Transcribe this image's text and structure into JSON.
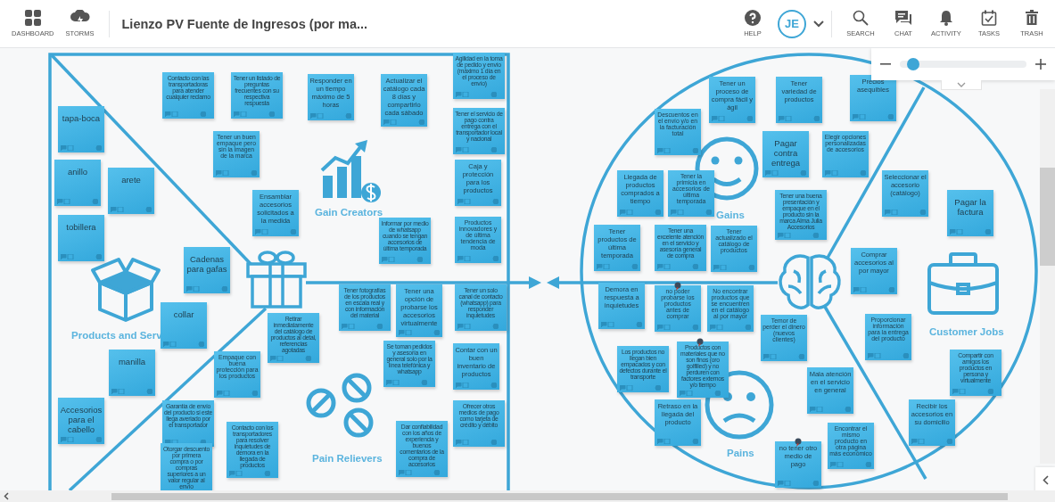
{
  "toolbar": {
    "left_buttons": [
      {
        "label": "DASHBOARD"
      },
      {
        "label": "STORMS"
      }
    ],
    "title": "Lienzo PV Fuente de Ingresos (por ma...",
    "avatar": "JE",
    "right_buttons": [
      {
        "label": "HELP"
      },
      {
        "label": "SEARCH"
      },
      {
        "label": "CHAT"
      },
      {
        "label": "ACTIVITY"
      },
      {
        "label": "TASKS"
      },
      {
        "label": "TRASH"
      }
    ]
  },
  "zoom": {
    "level": 0.07
  },
  "canvas": {
    "section_labels": [
      "Gain Creators",
      "Products and Serv",
      "Pain Relievers",
      "Gains",
      "Customer Jobs",
      "Pains"
    ],
    "notes": [
      {
        "text": "Contacto con las transportadoras para atender cualquier reclamo",
        "pinned": false
      },
      {
        "text": "Tener un listado de preguntas frecuentes con su respectiva respuesta",
        "pinned": false
      },
      {
        "text": "Responder en un tiempo máximo de 5 horas",
        "pinned": false
      },
      {
        "text": "Actualizar el catálogo cada 8 días y compartirlo cada sábado",
        "pinned": false
      },
      {
        "text": "Agilidad en la toma de pedido y envío (máximo 1 día en el proceso de envío)",
        "pinned": false
      },
      {
        "text": "tapa-boca",
        "pinned": false
      },
      {
        "text": "Tener el servicio de pago contra entrega con el transportador local y nacional",
        "pinned": false
      },
      {
        "text": "Tener un buen empaque pero sin la imagen de la marca",
        "pinned": false
      },
      {
        "text": "anillo",
        "pinned": false
      },
      {
        "text": "arete",
        "pinned": false
      },
      {
        "text": "Caja y protección para los productos",
        "pinned": false
      },
      {
        "text": "Ensamblar accesorios solicitados a la medida",
        "pinned": false
      },
      {
        "text": "tobillera",
        "pinned": false
      },
      {
        "text": "Informar por medio de whatsapp cuando se tengan accesorios de última temporada",
        "pinned": false
      },
      {
        "text": "Productos innovadores y de última tendencia de moda",
        "pinned": false
      },
      {
        "text": "Cadenas para gafas",
        "pinned": false
      },
      {
        "text": "collar",
        "pinned": false
      },
      {
        "text": "Tener fotografías de los productos en escala real y con información del material",
        "pinned": false
      },
      {
        "text": "Tener una opción de probarse los accesorios virtualmente",
        "pinned": false
      },
      {
        "text": "Tener un solo canal de contacto (whatsapp) para responder inquietudes",
        "pinned": false
      },
      {
        "text": "Retirar inmediatamente del catálogo de productos al detal, referencias agotadas",
        "pinned": false
      },
      {
        "text": "Empaque con buena protección para los productos",
        "pinned": false
      },
      {
        "text": "manilla",
        "pinned": false
      },
      {
        "text": "Se toman pedidos y asesoría en general solo por la línea telefónica y whatsapp",
        "pinned": false
      },
      {
        "text": "Contar con un buen inventario de productos",
        "pinned": false
      },
      {
        "text": "Accesorios para el cabello",
        "pinned": false
      },
      {
        "text": "Garantía de envío del producto si este llega averiado por el transportador",
        "pinned": false
      },
      {
        "text": "Contacto con los transportadores para resolver inquietudes de demora en la llegada de productos",
        "pinned": false
      },
      {
        "text": "Dar confiabilidad con los años de experiencia y buenos comentarios de la compra de accesorios",
        "pinned": false
      },
      {
        "text": "Ofrecer otros medios de pago como tarjeta de crédito y débito",
        "pinned": false
      },
      {
        "text": "Otorgar descuento por primera compra o por compras superiores a un valor regular al envío",
        "pinned": false
      },
      {
        "text": "Tener un proceso de compra fácil y ágil",
        "pinned": false
      },
      {
        "text": "Tener variedad de productos",
        "pinned": false
      },
      {
        "text": "Precios asequibles",
        "pinned": false
      },
      {
        "text": "Descuentos en el envío y/o en la facturación total",
        "pinned": false
      },
      {
        "text": "Pagar contra entrega",
        "pinned": false
      },
      {
        "text": "Elegir opciones personalizadas de accesorios",
        "pinned": false
      },
      {
        "text": "Llegada de productos comprados a tiempo",
        "pinned": false
      },
      {
        "text": "Tener la primicia en accesorios de última temporada",
        "pinned": false
      },
      {
        "text": "Tener una buena presentación y empaque en el producto sin la marca Alma Julia Accesorios",
        "pinned": false
      },
      {
        "text": "Seleccionar el accesorio (catálogo)",
        "pinned": false
      },
      {
        "text": "Pagar la factura",
        "pinned": false
      },
      {
        "text": "Tener productos de última temporada",
        "pinned": false
      },
      {
        "text": "Tener una excelente atención en el servicio y asesoría general de compra",
        "pinned": false
      },
      {
        "text": "Tener actualizado el catálogo de productos",
        "pinned": false
      },
      {
        "text": "Comprar accesorios al por mayor",
        "pinned": false
      },
      {
        "text": "Demora en respuesta a inquietudes",
        "pinned": false
      },
      {
        "text": "no poder probarse los productos antes de comprar",
        "pinned": true
      },
      {
        "text": "No encontrar productos que se encuentren en el catálogo al por mayor",
        "pinned": false
      },
      {
        "text": "Temor de perder el dinero (nuevos clientes)",
        "pinned": false
      },
      {
        "text": "Proporcionar información para la entrega del producto",
        "pinned": false
      },
      {
        "text": "Los productos no llegan bien empacados y con defectos durante el transporte",
        "pinned": false
      },
      {
        "text": "Productos con materiales que no son finos (oro golfilled) y no perduren con factores externos y/o tiempo",
        "pinned": true
      },
      {
        "text": "Compartir con amigos los productos en persona y virtualmente",
        "pinned": false
      },
      {
        "text": "Mala atención en el servicio en general",
        "pinned": false
      },
      {
        "text": "Retraso en la llegada del producto",
        "pinned": false
      },
      {
        "text": "Recibir los accesorios en su domicilio",
        "pinned": false
      },
      {
        "text": "Encontrar el mismo producto en otra página más económico",
        "pinned": false
      },
      {
        "text": "no tener otro medio de pago",
        "pinned": true
      }
    ]
  }
}
